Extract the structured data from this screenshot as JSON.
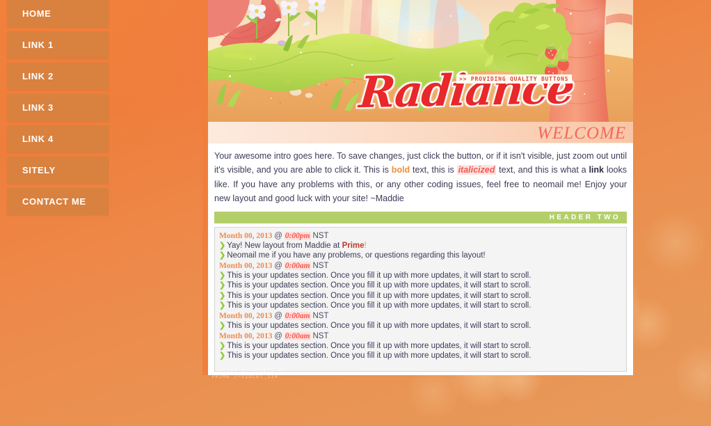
{
  "theme": {
    "bg_orange": "#ed8a4b",
    "nav_button_bg": "#d9813f",
    "accent_green": "#b4cf6a",
    "accent_red": "#e8282a",
    "welcome_color": "#f4675f",
    "container_border": "#f07f3c"
  },
  "nav": {
    "items": [
      {
        "label": "HOME"
      },
      {
        "label": "LINK 1"
      },
      {
        "label": "LINK 2"
      },
      {
        "label": "LINK 3"
      },
      {
        "label": "LINK 4"
      },
      {
        "label": "SITELY"
      },
      {
        "label": "CONTACT ME"
      }
    ]
  },
  "banner": {
    "site_name": "Radiance",
    "tagline": ">> PROVIDING QUALITY BUTTONS"
  },
  "welcome": {
    "title": "WELCOME",
    "intro_part_1": "Your awesome intro goes here. To save changes, just click the button, or if it isn't visible, just zoom out until it's visible, and you are able to click it. This is ",
    "bold_word": "bold",
    "intro_part_2": " text, this is ",
    "italic_word": "italicized",
    "intro_part_3": " text, and this is what a ",
    "link_word": "link",
    "intro_part_4": " looks like. If you have any problems with this, or any other coding issues, feel free to neomail me! Enjoy your new layout and good luck with your site! ~Maddie"
  },
  "header_two": {
    "label": "HEADER TWO"
  },
  "updates": {
    "arrow_glyph": "❯",
    "entries": [
      {
        "type": "date",
        "date": "Month 00, 2013",
        "at": "@",
        "time": "0:00pm",
        "zone": "NST"
      },
      {
        "type": "item",
        "text_before": "Yay! New layout from Maddie at ",
        "strong": "Prime",
        "text_after": "!"
      },
      {
        "type": "item",
        "text_before": "Neomail me if you have any problems, or questions regarding this layout!",
        "strong": "",
        "text_after": ""
      },
      {
        "type": "date",
        "date": "Month 00, 2013",
        "at": "@",
        "time": "0:00am",
        "zone": "NST"
      },
      {
        "type": "item",
        "text_before": "This is your updates section. Once you fill it up with more updates, it will start to scroll.",
        "strong": "",
        "text_after": ""
      },
      {
        "type": "item",
        "text_before": "This is your updates section. Once you fill it up with more updates, it will start to scroll.",
        "strong": "",
        "text_after": ""
      },
      {
        "type": "item",
        "text_before": "This is your updates section. Once you fill it up with more updates, it will start to scroll.",
        "strong": "",
        "text_after": ""
      },
      {
        "type": "item",
        "text_before": "This is your updates section. Once you fill it up with more updates, it will start to scroll.",
        "strong": "",
        "text_after": ""
      },
      {
        "type": "date",
        "date": "Month 00, 2013",
        "at": "@",
        "time": "0:00am",
        "zone": "NST"
      },
      {
        "type": "item",
        "text_before": "This is your updates section. Once you fill it up with more updates, it will start to scroll.",
        "strong": "",
        "text_after": ""
      },
      {
        "type": "date",
        "date": "Month 00, 2013",
        "at": "@",
        "time": "0:00am",
        "zone": "NST"
      },
      {
        "type": "item",
        "text_before": "This is your updates section. Once you fill it up with more updates, it will start to scroll.",
        "strong": "",
        "text_after": ""
      },
      {
        "type": "item",
        "text_before": "This is your updates section. Once you fill it up with more updates, it will start to scroll.",
        "strong": "",
        "text_after": ""
      }
    ]
  },
  "credit": {
    "line1": "LAYOUT BY MADDIE AT",
    "line2": "PRIME /~VIOLET_114"
  }
}
